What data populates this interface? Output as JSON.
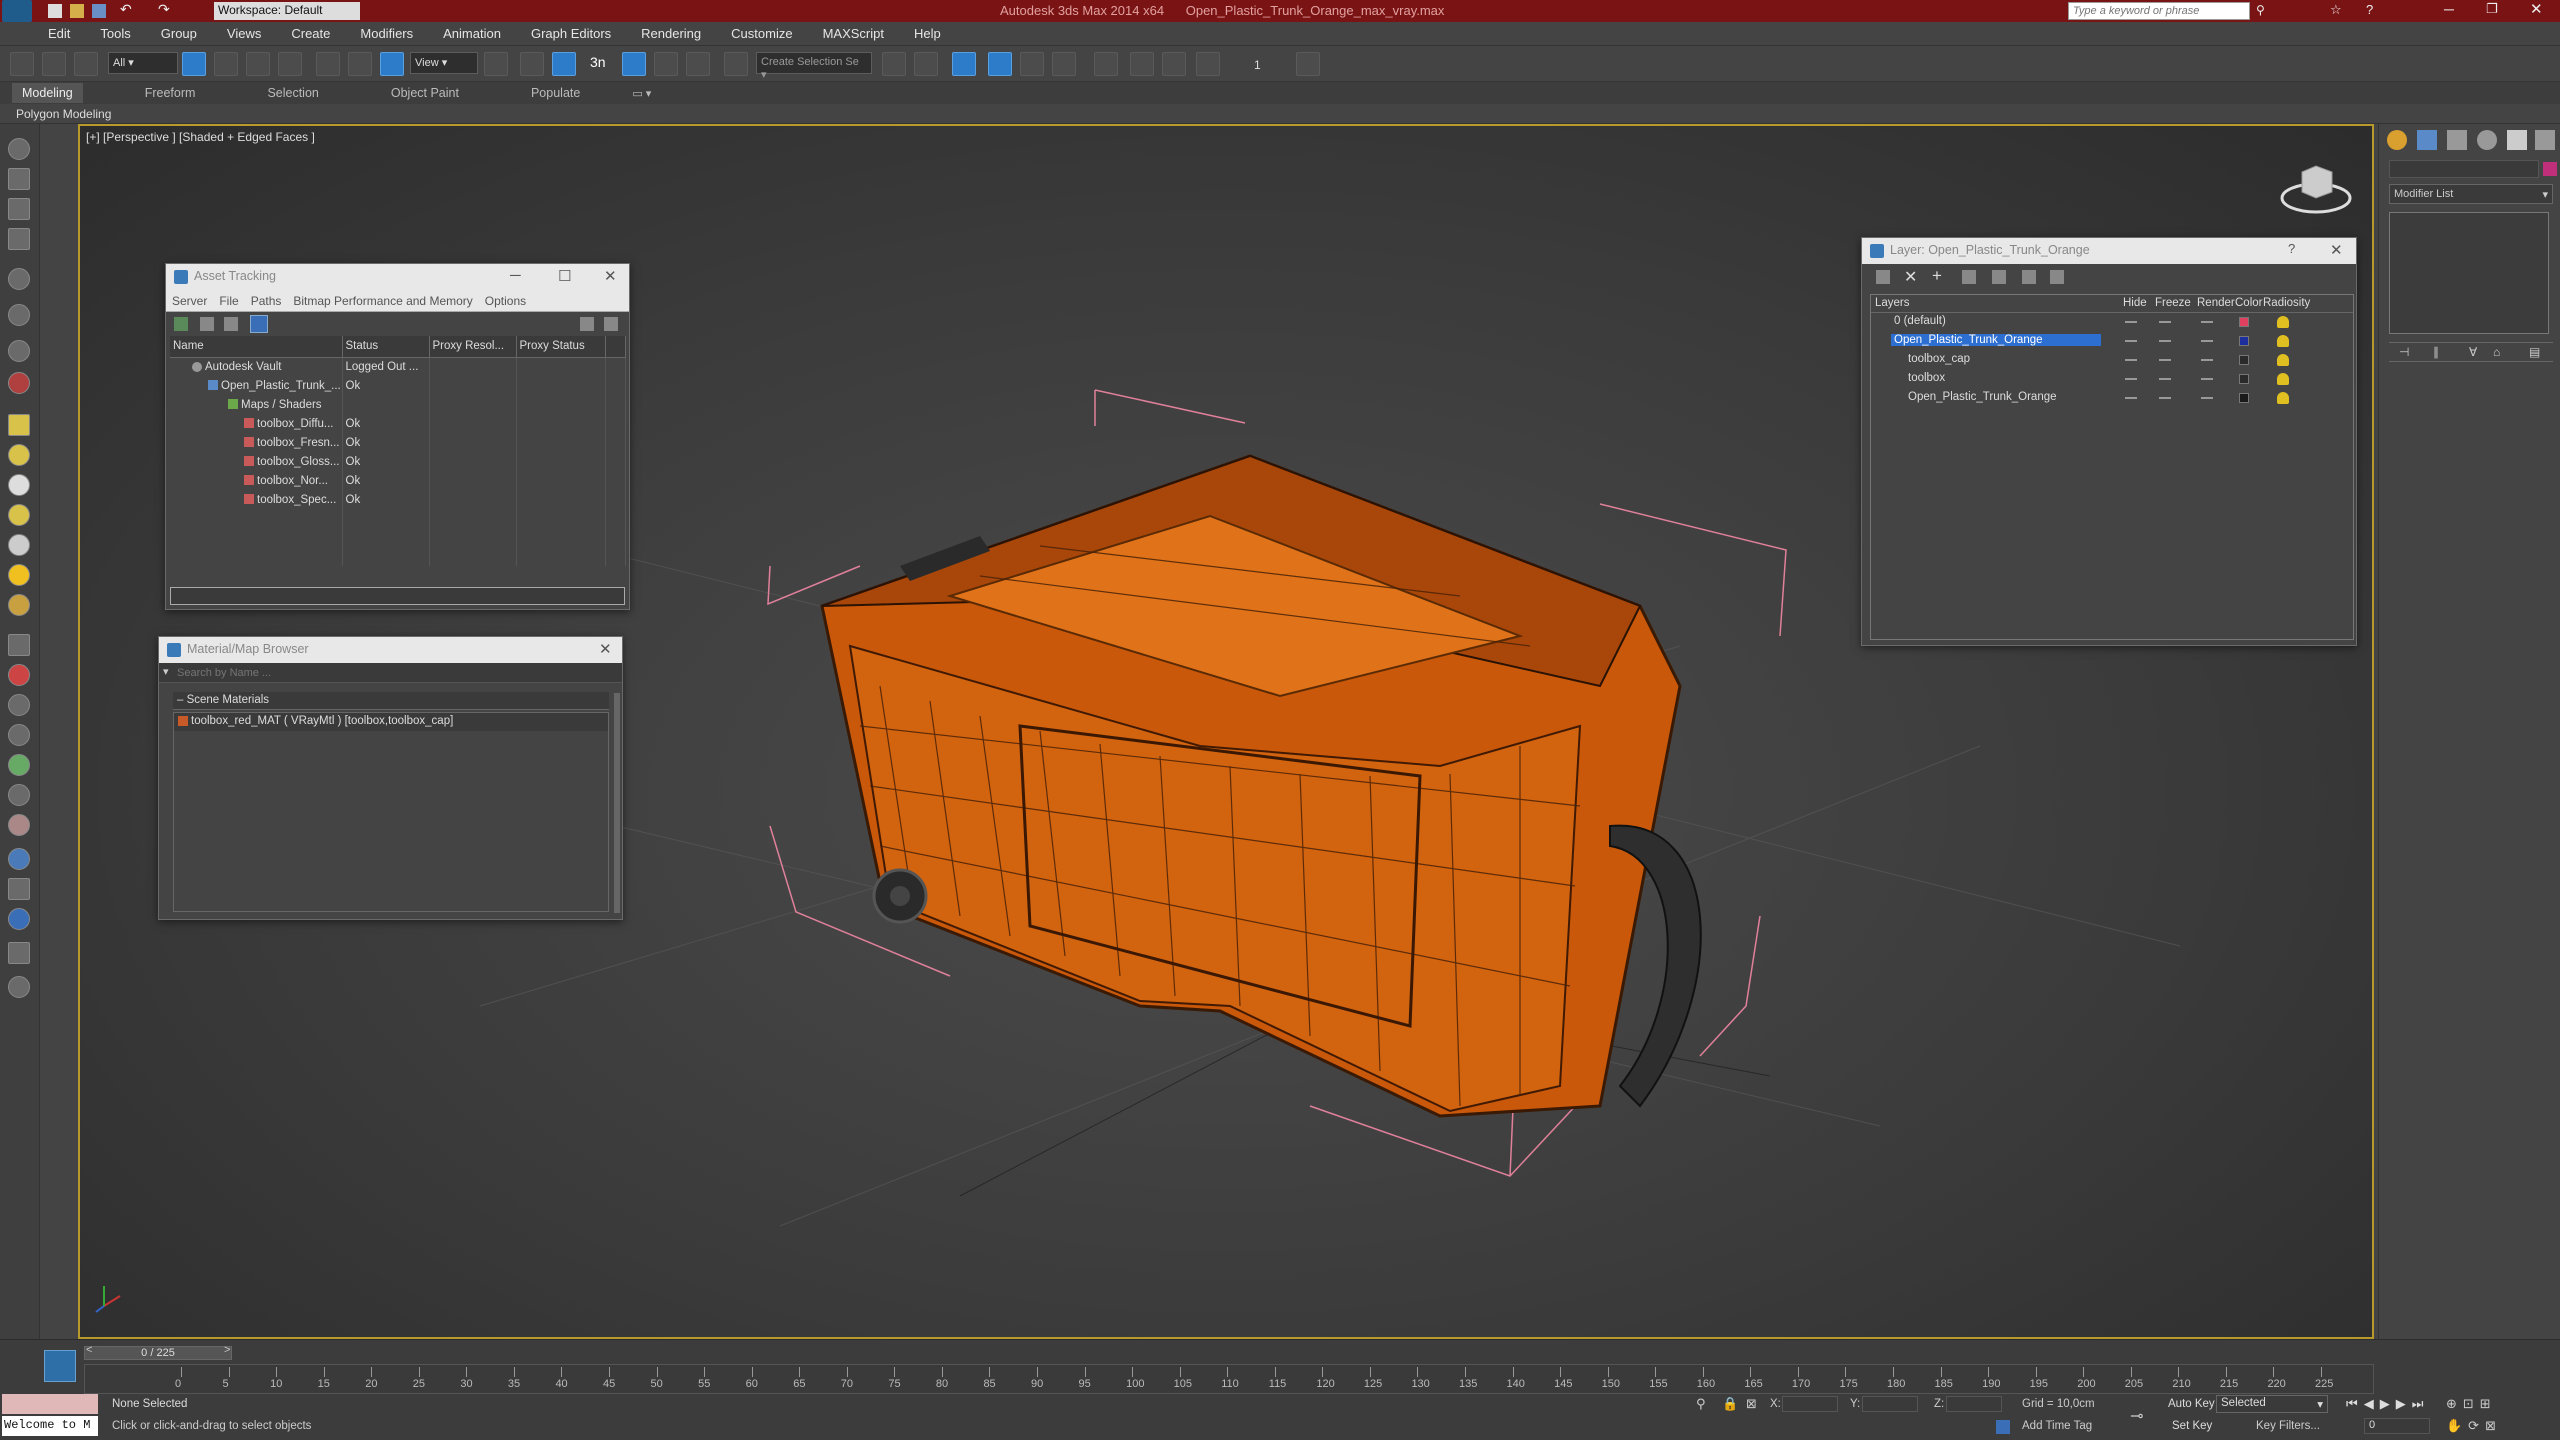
{
  "titlebar": {
    "app_title": "Autodesk 3ds Max 2014 x64",
    "file_name": "Open_Plastic_Trunk_Orange_max_vray.max",
    "workspace": "Workspace: Default",
    "search_placeholder": "Type a keyword or phrase"
  },
  "menu": [
    "Edit",
    "Tools",
    "Group",
    "Views",
    "Create",
    "Modifiers",
    "Animation",
    "Graph Editors",
    "Rendering",
    "Customize",
    "MAXScript",
    "Help"
  ],
  "toolbar": {
    "filter": "All",
    "ref_coord": "View",
    "selection_set": "Create Selection Se",
    "snap_num": "3",
    "spinner_label": "1"
  },
  "ribbon": {
    "tabs": [
      "Modeling",
      "Freeform",
      "Selection",
      "Object Paint",
      "Populate"
    ],
    "sub": "Polygon Modeling"
  },
  "viewport": {
    "label": "[+] [Perspective ] [Shaded + Edged Faces ]"
  },
  "asset_tracking": {
    "title": "Asset Tracking",
    "menu": [
      "Server",
      "File",
      "Paths",
      "Bitmap Performance and Memory",
      "Options"
    ],
    "columns": [
      "Name",
      "Status",
      "Proxy Resol...",
      "Proxy Status"
    ],
    "rows": [
      {
        "name": "Autodesk Vault",
        "status": "Logged Out ..."
      },
      {
        "name": "Open_Plastic_Trunk_...",
        "status": "Ok"
      },
      {
        "name": "Maps / Shaders",
        "status": ""
      },
      {
        "name": "toolbox_Diffu...",
        "status": "Ok"
      },
      {
        "name": "toolbox_Fresn...",
        "status": "Ok"
      },
      {
        "name": "toolbox_Gloss...",
        "status": "Ok"
      },
      {
        "name": "toolbox_Nor...",
        "status": "Ok"
      },
      {
        "name": "toolbox_Spec...",
        "status": "Ok"
      }
    ]
  },
  "material_browser": {
    "title": "Material/Map Browser",
    "search_placeholder": "Search by Name ...",
    "group": "Scene Materials",
    "item": "toolbox_red_MAT ( VRayMtl ) [toolbox,toolbox_cap]"
  },
  "layer_window": {
    "title": "Layer: Open_Plastic_Trunk_Orange",
    "help": "?",
    "columns": [
      "Layers",
      "Hide",
      "Freeze",
      "Render",
      "Color",
      "Radiosity"
    ],
    "rows": [
      {
        "name": "0 (default)",
        "color": "#e04060",
        "selected": false
      },
      {
        "name": "Open_Plastic_Trunk_Orange",
        "color": "#1d2f9c",
        "selected": true
      },
      {
        "name": "toolbox_cap",
        "color": "#2a2a2a",
        "selected": false
      },
      {
        "name": "toolbox",
        "color": "#2a2a2a",
        "selected": false
      },
      {
        "name": "Open_Plastic_Trunk_Orange",
        "color": "#1a1a1a",
        "selected": false
      }
    ]
  },
  "command_panel": {
    "modifier_list": "Modifier List"
  },
  "timeline": {
    "frame": "0 / 225",
    "ticks": [
      "0",
      "5",
      "10",
      "15",
      "20",
      "25",
      "30",
      "35",
      "40",
      "45",
      "50",
      "55",
      "60",
      "65",
      "70",
      "75",
      "80",
      "85",
      "90",
      "95",
      "100",
      "105",
      "110",
      "115",
      "120",
      "125",
      "130",
      "135",
      "140",
      "145",
      "150",
      "155",
      "160",
      "165",
      "170",
      "175",
      "180",
      "185",
      "190",
      "195",
      "200",
      "205",
      "210",
      "215",
      "220",
      "225"
    ]
  },
  "status": {
    "welcome": "Welcome to M",
    "selection": "None Selected",
    "prompt": "Click or click-and-drag to select objects",
    "x_label": "X:",
    "y_label": "Y:",
    "z_label": "Z:",
    "grid": "Grid = 10,0cm",
    "add_time_tag": "Add Time Tag",
    "auto_key": "Auto Key",
    "set_key": "Set Key",
    "selected": "Selected",
    "key_filters": "Key Filters...",
    "frame_field": "0"
  },
  "colors": {
    "titlebar": "#7a1414",
    "accent_blue": "#2d7cc9",
    "trunk_orange": "#d9620a",
    "viewport_border": "#b89a2a"
  }
}
